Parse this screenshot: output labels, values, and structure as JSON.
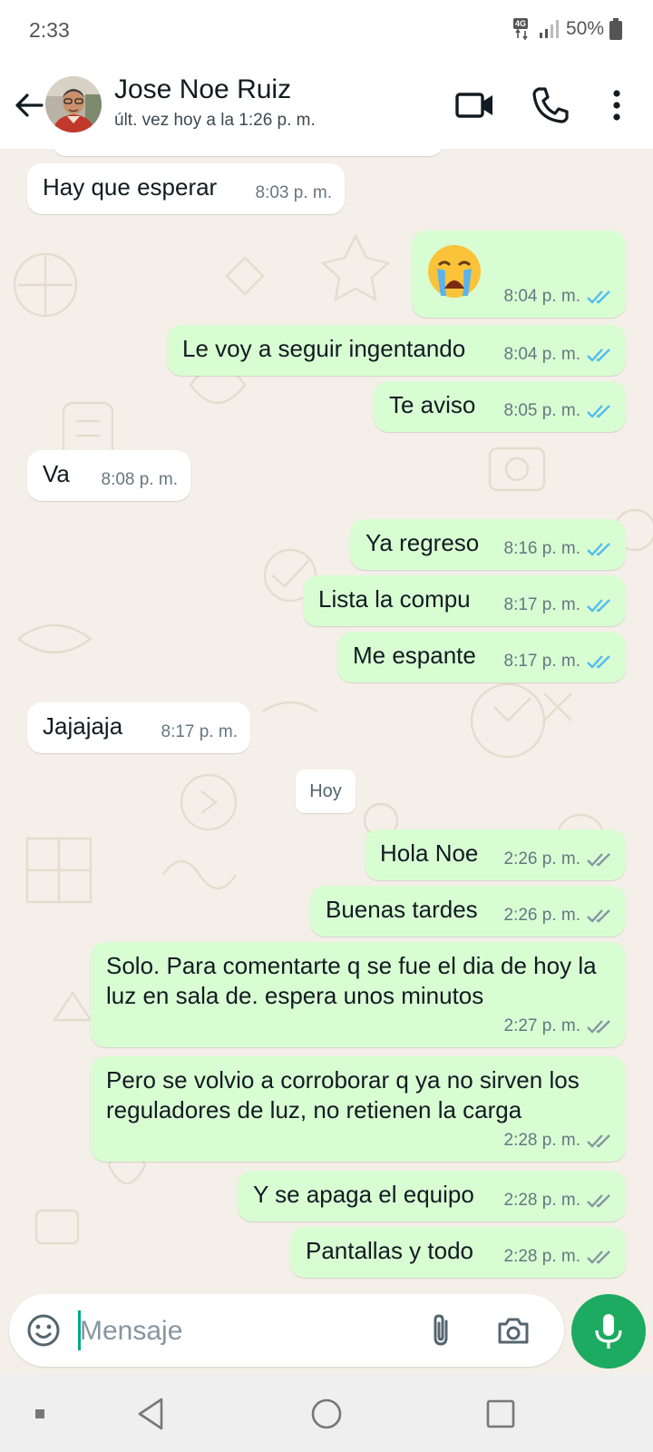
{
  "status_bar": {
    "time": "2:33",
    "network": "4G",
    "battery": "50%"
  },
  "header": {
    "contact_name": "Jose Noe Ruiz",
    "last_seen": "últ. vez hoy a la 1:26 p. m.",
    "icons": [
      "back-arrow-icon",
      "video-call-icon",
      "voice-call-icon",
      "more-options-icon"
    ]
  },
  "messages": [
    {
      "text": "Hay que esperar",
      "time": "8:03 p. m."
    },
    {
      "emoji": "loudly-crying-face",
      "time": "8:04 p. m.",
      "ticks": "read"
    },
    {
      "text": "Le voy a seguir ingentando",
      "time": "8:04 p. m.",
      "ticks": "read"
    },
    {
      "text": "Te aviso",
      "time": "8:05 p. m.",
      "ticks": "read"
    },
    {
      "text": "Va",
      "time": "8:08 p. m."
    },
    {
      "text": "Ya regreso",
      "time": "8:16 p. m.",
      "ticks": "read"
    },
    {
      "text": "Lista la compu",
      "time": "8:17 p. m.",
      "ticks": "read"
    },
    {
      "text": "Me espante",
      "time": "8:17 p. m.",
      "ticks": "read"
    },
    {
      "text": "Jajajaja",
      "time": "8:17 p. m."
    },
    {
      "text": "Hola Noe",
      "time": "2:26 p. m.",
      "ticks": "delivered"
    },
    {
      "text": "Buenas tardes",
      "time": "2:26 p. m.",
      "ticks": "delivered"
    },
    {
      "text": "Solo. Para comentarte q se fue el dia de hoy la luz en sala de. espera unos minutos",
      "time": "2:27 p. m.",
      "ticks": "delivered"
    },
    {
      "text": "Pero se volvio a corroborar q ya no sirven los reguladores de luz, no retienen la carga",
      "time": "2:28 p. m.",
      "ticks": "delivered"
    },
    {
      "text": "Y se apaga el equipo",
      "time": "2:28 p. m.",
      "ticks": "delivered"
    },
    {
      "text": "Pantallas y todo",
      "time": "2:28 p. m.",
      "ticks": "delivered"
    }
  ],
  "date_divider": "Hoy",
  "composer": {
    "placeholder": "Mensaje",
    "icons": [
      "emoji-icon",
      "attach-icon",
      "camera-icon",
      "mic-icon"
    ]
  },
  "colors": {
    "outgoing_bubble": "#d9fdd3",
    "incoming_bubble": "#ffffff",
    "read_ticks": "#53bdeb",
    "accent": "#1daa61"
  }
}
